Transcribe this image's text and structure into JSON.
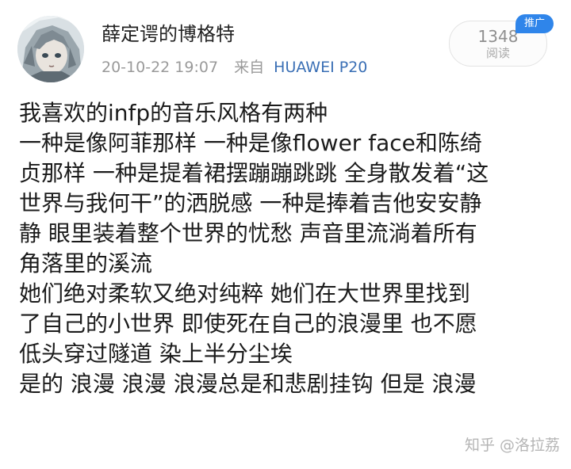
{
  "post": {
    "author": "薛定谔的博格特",
    "date": "20-10-22 19:07",
    "source_prefix": "来自",
    "device": "HUAWEI P20",
    "views_count": "1348",
    "views_label": "阅读",
    "promo_badge": "推广"
  },
  "content": {
    "lines": [
      "我喜欢的infp的音乐风格有两种",
      "一种是像阿菲那样 一种是像flower face和陈绮",
      "贞那样 一种是提着裙摆蹦蹦跳跳 全身散发着“这",
      "世界与我何干”的洒脱感 一种是捧着吉他安安静",
      "静 眼里装着整个世界的忧愁 声音里流淌着所有",
      "角落里的溪流",
      "她们绝对柔软又绝对纯粹 她们在大世界里找到",
      "了自己的小世界 即使死在自己的浪漫里 也不愿",
      "低头穿过隧道 染上半分尘埃",
      "是的 浪漫 浪漫 浪漫总是和悲剧挂钩 但是 浪漫"
    ]
  },
  "watermark": "知乎 @洛拉荔"
}
